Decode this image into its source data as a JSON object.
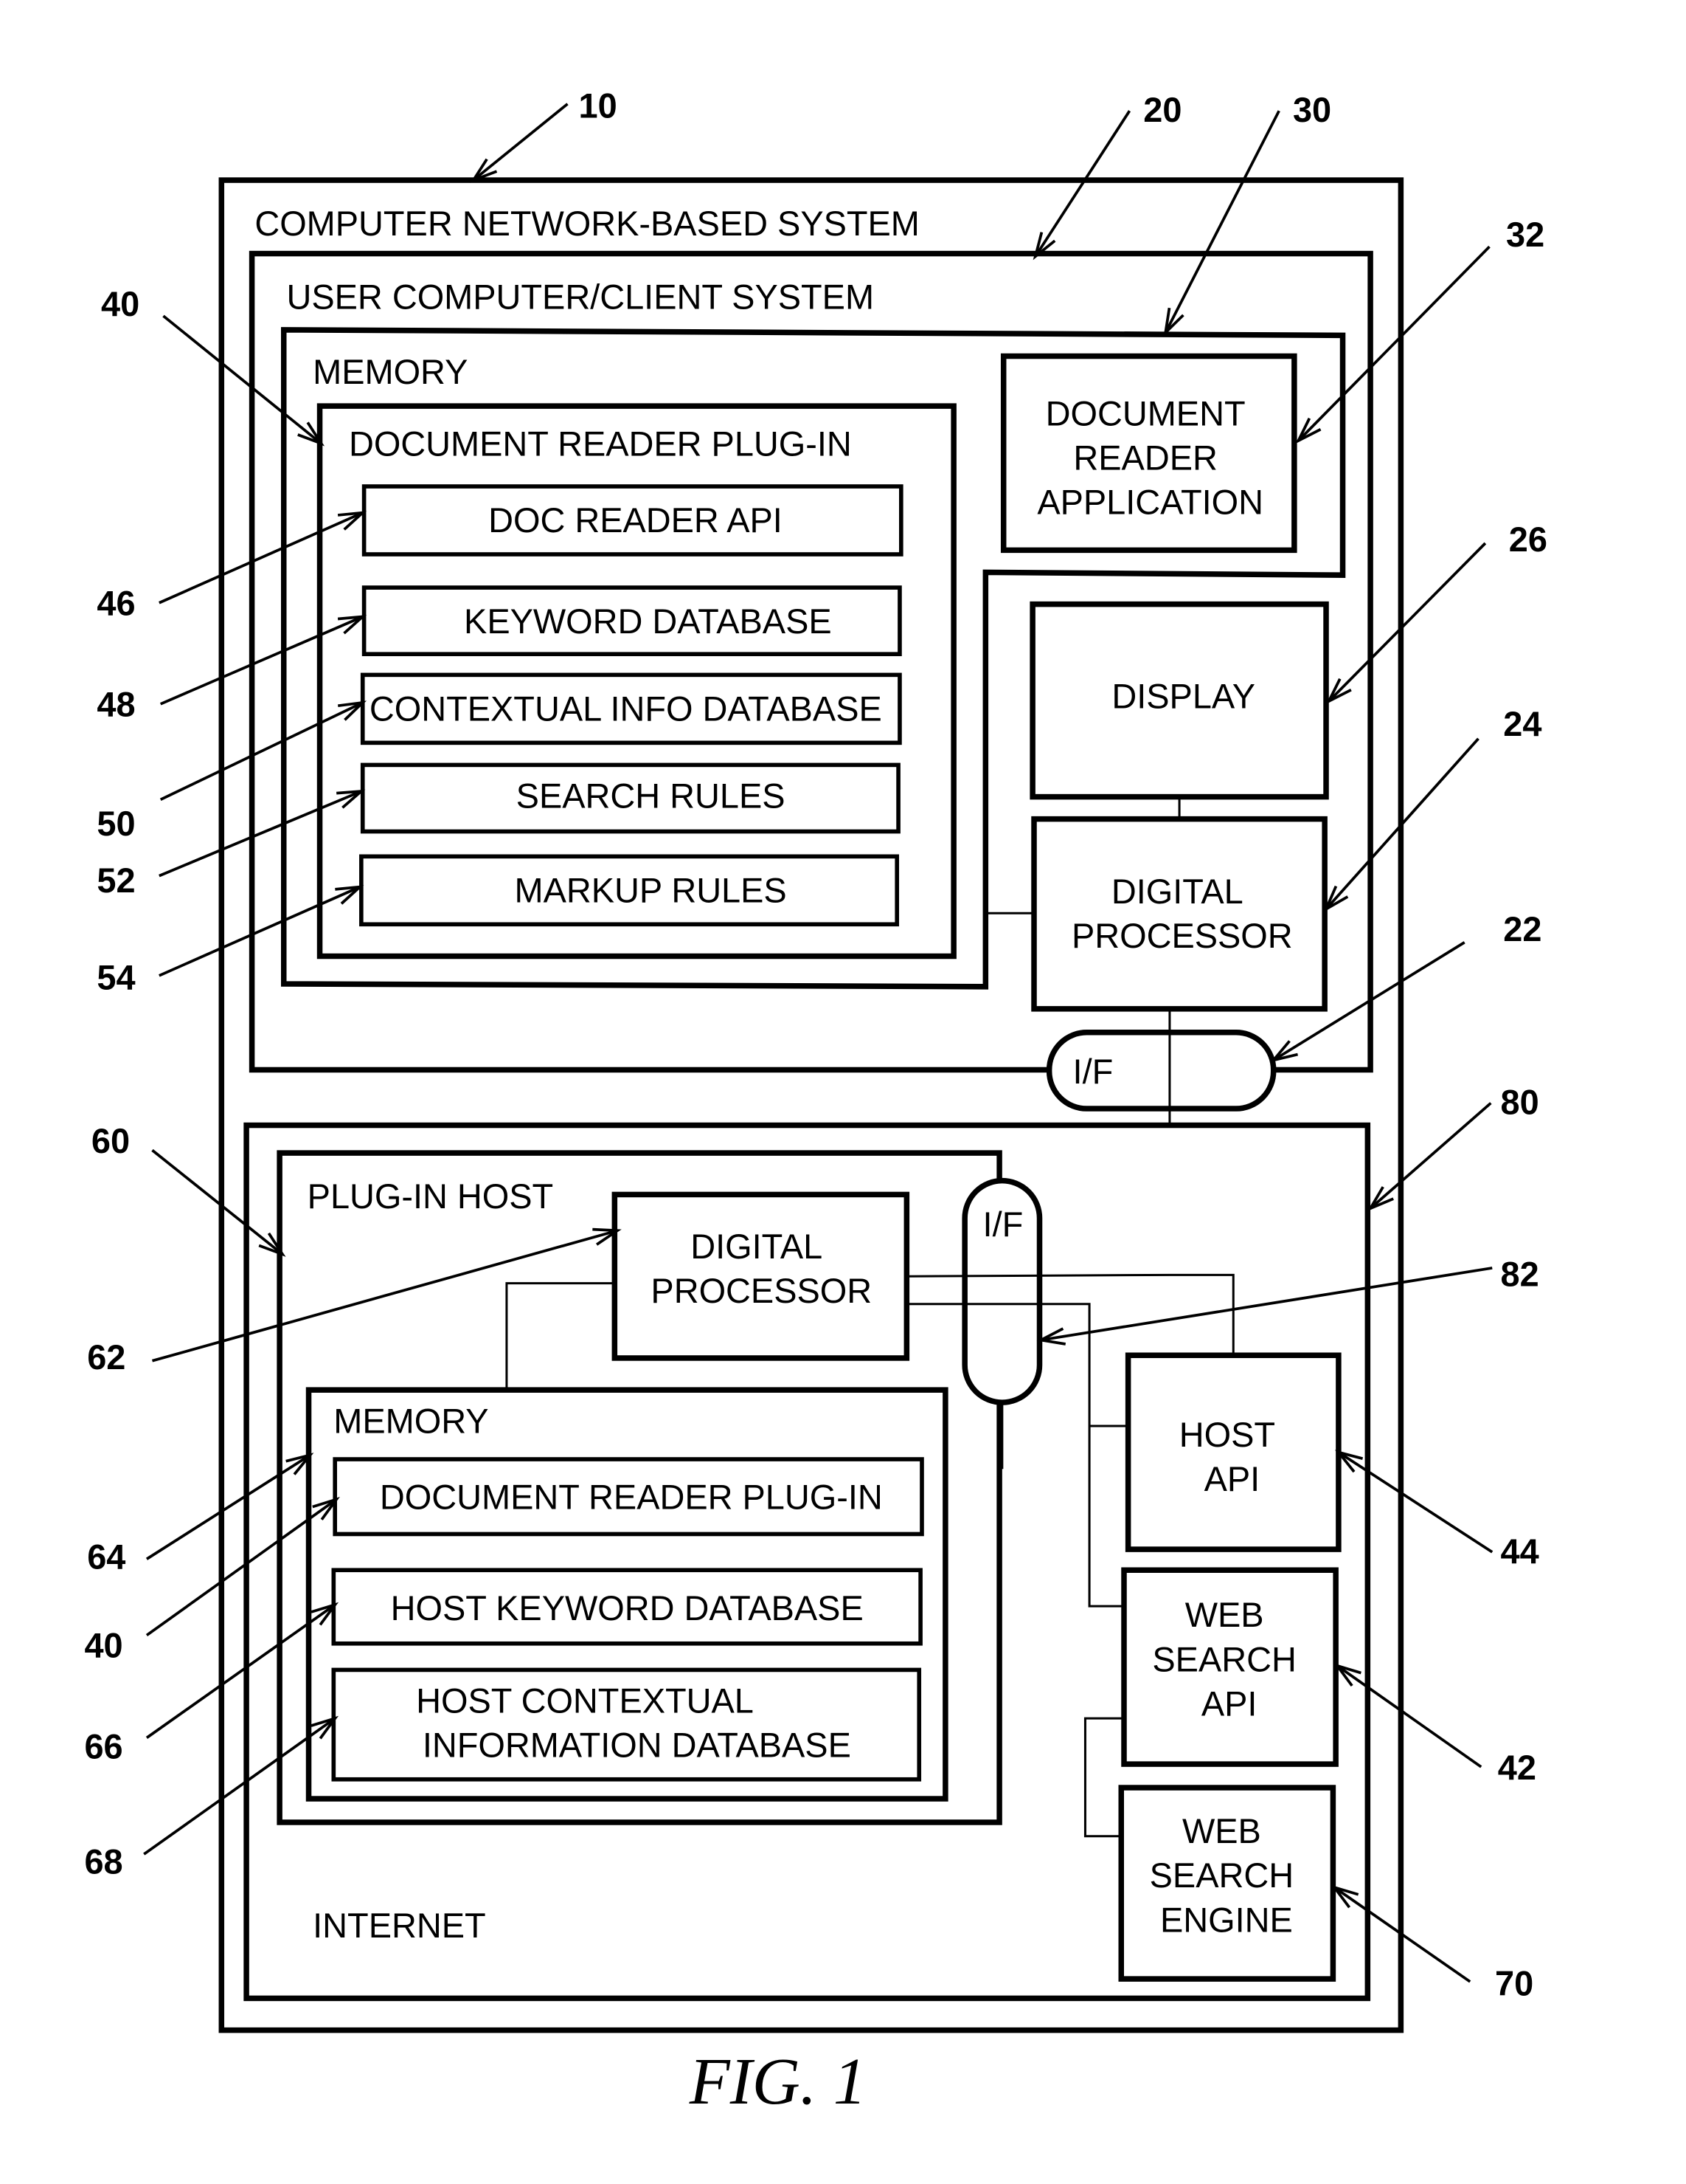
{
  "figure": {
    "caption": "FIG. 1",
    "colors": {
      "stroke": "#000000",
      "background": "#ffffff"
    }
  },
  "system": {
    "ref": "10",
    "label": "COMPUTER NETWORK-BASED SYSTEM"
  },
  "client": {
    "ref": "20",
    "label": "USER COMPUTER/CLIENT SYSTEM",
    "memory": {
      "ref": "30",
      "label": "MEMORY",
      "plugin": {
        "ref": "40",
        "label": "DOCUMENT READER PLUG-IN",
        "items": [
          {
            "ref": "46",
            "label": "DOC READER API"
          },
          {
            "ref": "48",
            "label": "KEYWORD DATABASE"
          },
          {
            "ref": "50",
            "label": "CONTEXTUAL INFO DATABASE"
          },
          {
            "ref": "52",
            "label": "SEARCH RULES"
          },
          {
            "ref": "54",
            "label": "MARKUP RULES"
          }
        ]
      },
      "reader_app": {
        "ref": "32",
        "lines": [
          "DOCUMENT",
          "READER",
          "APPLICATION"
        ]
      }
    },
    "display": {
      "ref": "26",
      "label": "DISPLAY"
    },
    "processor": {
      "ref": "24",
      "lines": [
        "DIGITAL",
        "PROCESSOR"
      ]
    },
    "interface": {
      "ref": "22",
      "label": "I/F"
    }
  },
  "internet": {
    "ref": "80",
    "label": "INTERNET",
    "host": {
      "ref": "60",
      "label": "PLUG-IN HOST",
      "processor": {
        "ref": "62",
        "lines": [
          "DIGITAL",
          "PROCESSOR"
        ]
      },
      "interface": {
        "ref": "82",
        "label": "I/F"
      },
      "memory": {
        "ref": "64",
        "label": "MEMORY",
        "items": [
          {
            "ref": "40",
            "lines": [
              "DOCUMENT READER PLUG-IN"
            ]
          },
          {
            "ref": "66",
            "lines": [
              "HOST KEYWORD DATABASE"
            ]
          },
          {
            "ref": "68",
            "lines": [
              "HOST CONTEXTUAL",
              "INFORMATION DATABASE"
            ]
          }
        ]
      }
    },
    "host_api": {
      "ref": "44",
      "lines": [
        "HOST",
        "API"
      ]
    },
    "web_search_api": {
      "ref": "42",
      "lines": [
        "WEB",
        "SEARCH",
        "API"
      ]
    },
    "web_search_engine": {
      "ref": "70",
      "lines": [
        "WEB",
        "SEARCH",
        "ENGINE"
      ]
    }
  }
}
